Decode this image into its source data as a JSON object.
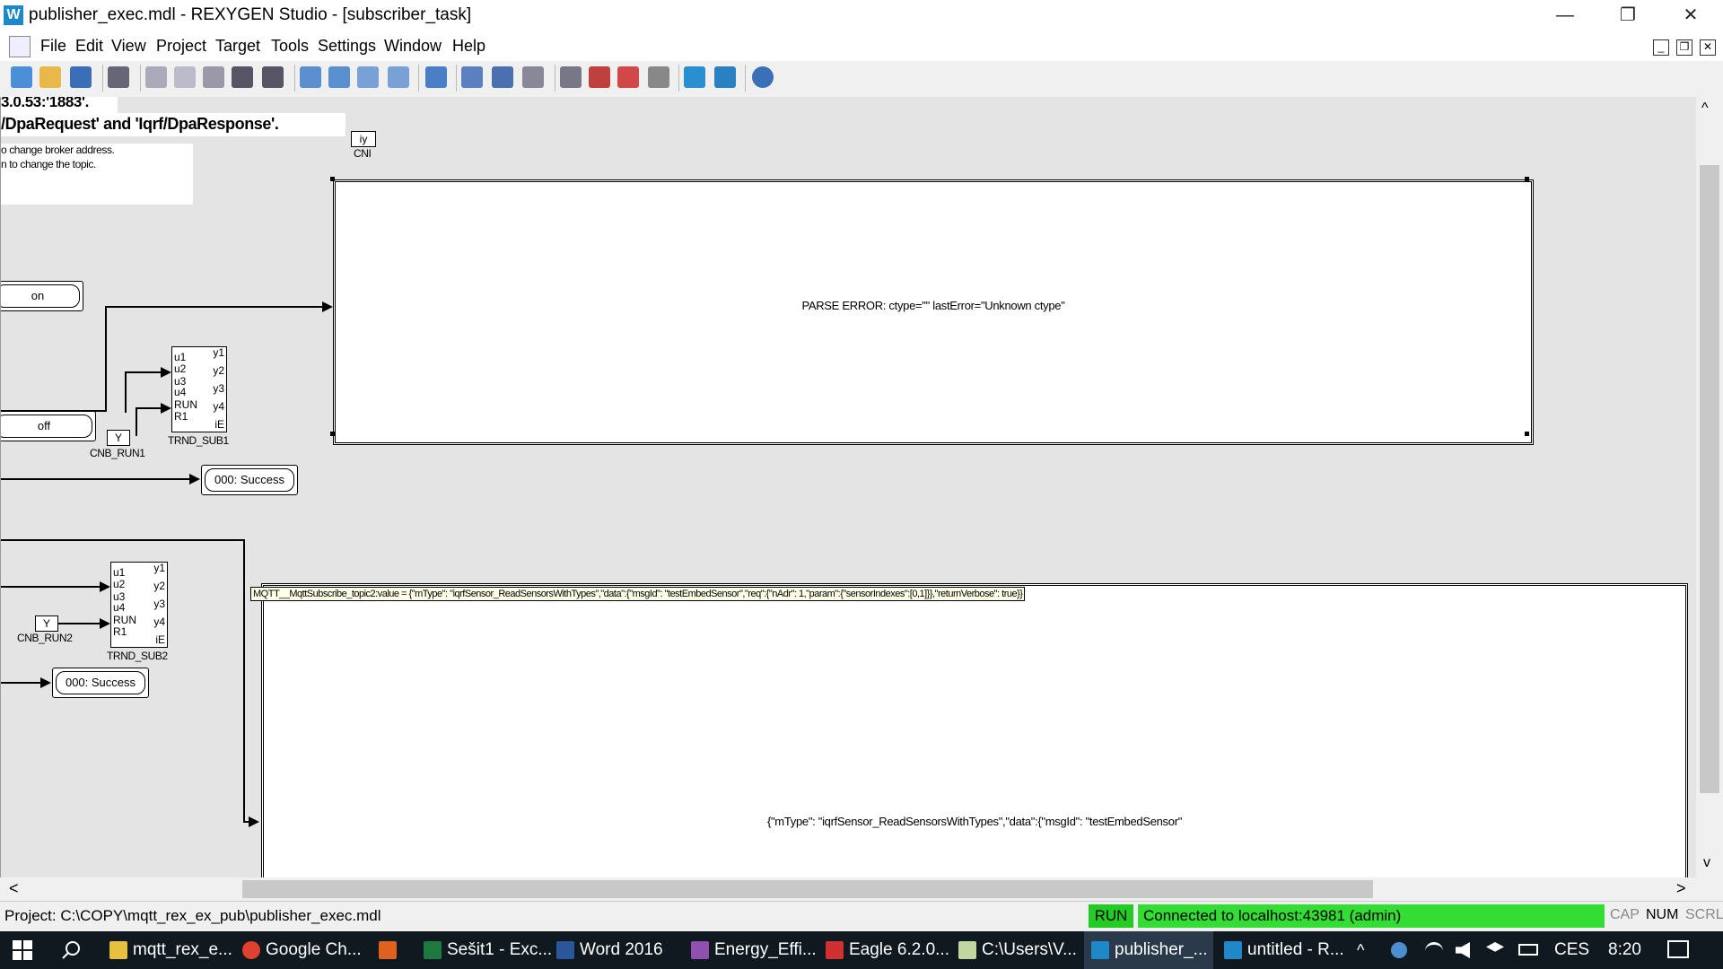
{
  "window": {
    "title": "publisher_exec.mdl - REXYGEN Studio - [subscriber_task]",
    "app_icon_glyph": "W",
    "minimize_glyph": "—",
    "restore_glyph": "❐",
    "close_glyph": "✕"
  },
  "menu": {
    "items": [
      "File",
      "Edit",
      "View",
      "Project",
      "Target",
      "Tools",
      "Settings",
      "Window",
      "Help"
    ],
    "mdi_minimize": "_",
    "mdi_restore": "❐",
    "mdi_close": "✕"
  },
  "toolbar": {
    "icons": [
      "new-icon",
      "open-icon",
      "save-icon",
      "print-icon",
      "cut-icon",
      "copy-icon",
      "paste-icon",
      "undo-icon",
      "redo-icon",
      "zoom-in-icon",
      "zoom-out-icon",
      "zoom-fit-icon",
      "zoom-all-icon",
      "build-icon",
      "compile-icon",
      "download-icon",
      "upload-icon",
      "connect-icon",
      "disconnect-icon",
      "refresh-icon",
      "list-icon",
      "watch-icon",
      "trend-icon",
      "info-icon"
    ]
  },
  "diagram": {
    "note_line1": "3.0.53:'1883'.",
    "note_line2": "/DpaRequest' and 'Iqrf/DpaResponse'.",
    "note_line3": "o change broker address.",
    "note_line4": "n to change the topic.",
    "cni_label_inner": "iy",
    "cni_label": "CNI",
    "on_value": "on",
    "off_value": "off",
    "parse_error_text": "PARSE ERROR: ctype=\"\" lastError=\"Unknown ctype\"",
    "trnd1": {
      "name": "TRND_SUB1",
      "inputs": [
        "u1",
        "u2",
        "u3",
        "u4",
        "RUN",
        "R1"
      ],
      "outputs": [
        "y1",
        "y2",
        "y3",
        "y4",
        "iE"
      ]
    },
    "cnb_run1": {
      "value": "Y",
      "name": "CNB_RUN1"
    },
    "status1": "000: Success",
    "trnd2": {
      "name": "TRND_SUB2",
      "inputs": [
        "u1",
        "u2",
        "u3",
        "u4",
        "RUN",
        "R1"
      ],
      "outputs": [
        "y1",
        "y2",
        "y3",
        "y4",
        "iE"
      ]
    },
    "cnb_run2": {
      "value": "Y",
      "name": "CNB_RUN2"
    },
    "status2": "000: Success",
    "tooltip": "MQTT__MqttSubscribe_topic2:value = {\"mType\": \"iqrfSensor_ReadSensorsWithTypes\",\"data\":{\"msgId\": \"testEmbedSensor\",\"req\":{\"nAdr\": 1,\"param\":{\"sensorIndexes\":[0,1]}},\"returnVerbose\": true}}",
    "display_text": "{\"mType\": \"iqrfSensor_ReadSensorsWithTypes\",\"data\":{\"msgId\": \"testEmbedSensor\""
  },
  "scrollbars": {
    "up": "^",
    "down": "v",
    "left": "<",
    "right": ">"
  },
  "status": {
    "project_path": "Project: C:\\COPY\\mqtt_rex_ex_pub\\publisher_exec.mdl",
    "run": "RUN",
    "connection": "Connected to localhost:43981 (admin)",
    "cap": "CAP",
    "num": "NUM",
    "scrl": "SCRL",
    "run_color": "#22cc22",
    "connection_color": "#33dd33"
  },
  "taskbar": {
    "items": [
      {
        "label": "mqtt_rex_e...",
        "icon": "folder-icon"
      },
      {
        "label": "Google Ch...",
        "icon": "chrome-icon"
      },
      {
        "label": "",
        "icon": "matlab-icon"
      },
      {
        "label": "Sešit1 - Exc...",
        "icon": "excel-icon"
      },
      {
        "label": "Word 2016",
        "icon": "word-icon"
      },
      {
        "label": "Energy_Effi...",
        "icon": "onenote-icon"
      },
      {
        "label": "Eagle 6.2.0...",
        "icon": "eagle-icon"
      },
      {
        "label": "C:\\Users\\V...",
        "icon": "notepad-icon"
      },
      {
        "label": "publisher_...",
        "icon": "rexygen-icon"
      },
      {
        "label": "untitled - R...",
        "icon": "rexygen-icon"
      }
    ],
    "language": "CES",
    "time": "8:20"
  }
}
